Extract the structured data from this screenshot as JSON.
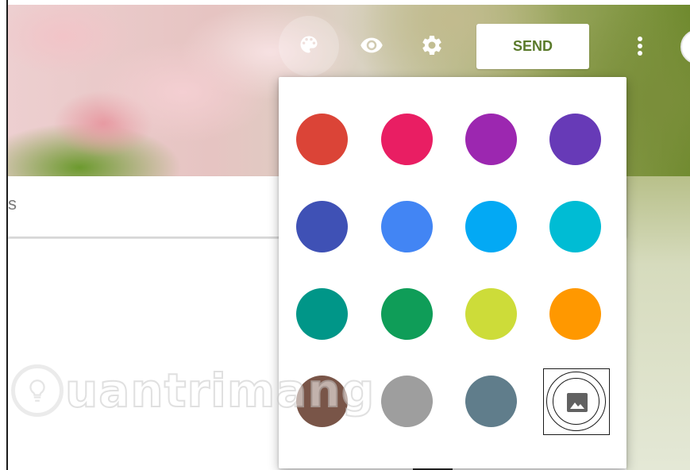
{
  "toolbar": {
    "palette_icon": "palette-icon",
    "preview_icon": "eye-icon",
    "settings_icon": "gear-icon",
    "send_label": "SEND",
    "more_icon": "more-vert-icon",
    "accent_color": "#5a7a2a"
  },
  "title_card": {
    "partial_text": "s"
  },
  "theme_picker": {
    "colors": [
      {
        "name": "red",
        "hex": "#db4437"
      },
      {
        "name": "pink",
        "hex": "#e91e63"
      },
      {
        "name": "purple",
        "hex": "#9c27b0"
      },
      {
        "name": "deep-purple",
        "hex": "#673ab7"
      },
      {
        "name": "indigo",
        "hex": "#3f51b5"
      },
      {
        "name": "blue",
        "hex": "#4285f4"
      },
      {
        "name": "light-blue",
        "hex": "#03a9f4"
      },
      {
        "name": "cyan",
        "hex": "#00bcd4"
      },
      {
        "name": "teal",
        "hex": "#009688"
      },
      {
        "name": "green",
        "hex": "#0f9d58"
      },
      {
        "name": "lime",
        "hex": "#cddc39"
      },
      {
        "name": "orange",
        "hex": "#ff9800"
      },
      {
        "name": "brown",
        "hex": "#795548"
      },
      {
        "name": "grey",
        "hex": "#9e9e9e"
      },
      {
        "name": "blue-grey",
        "hex": "#607d8b"
      }
    ],
    "image_option_icon": "image-icon"
  },
  "watermark": {
    "text": "uantrimang",
    "logo_icon": "lightbulb-icon"
  }
}
